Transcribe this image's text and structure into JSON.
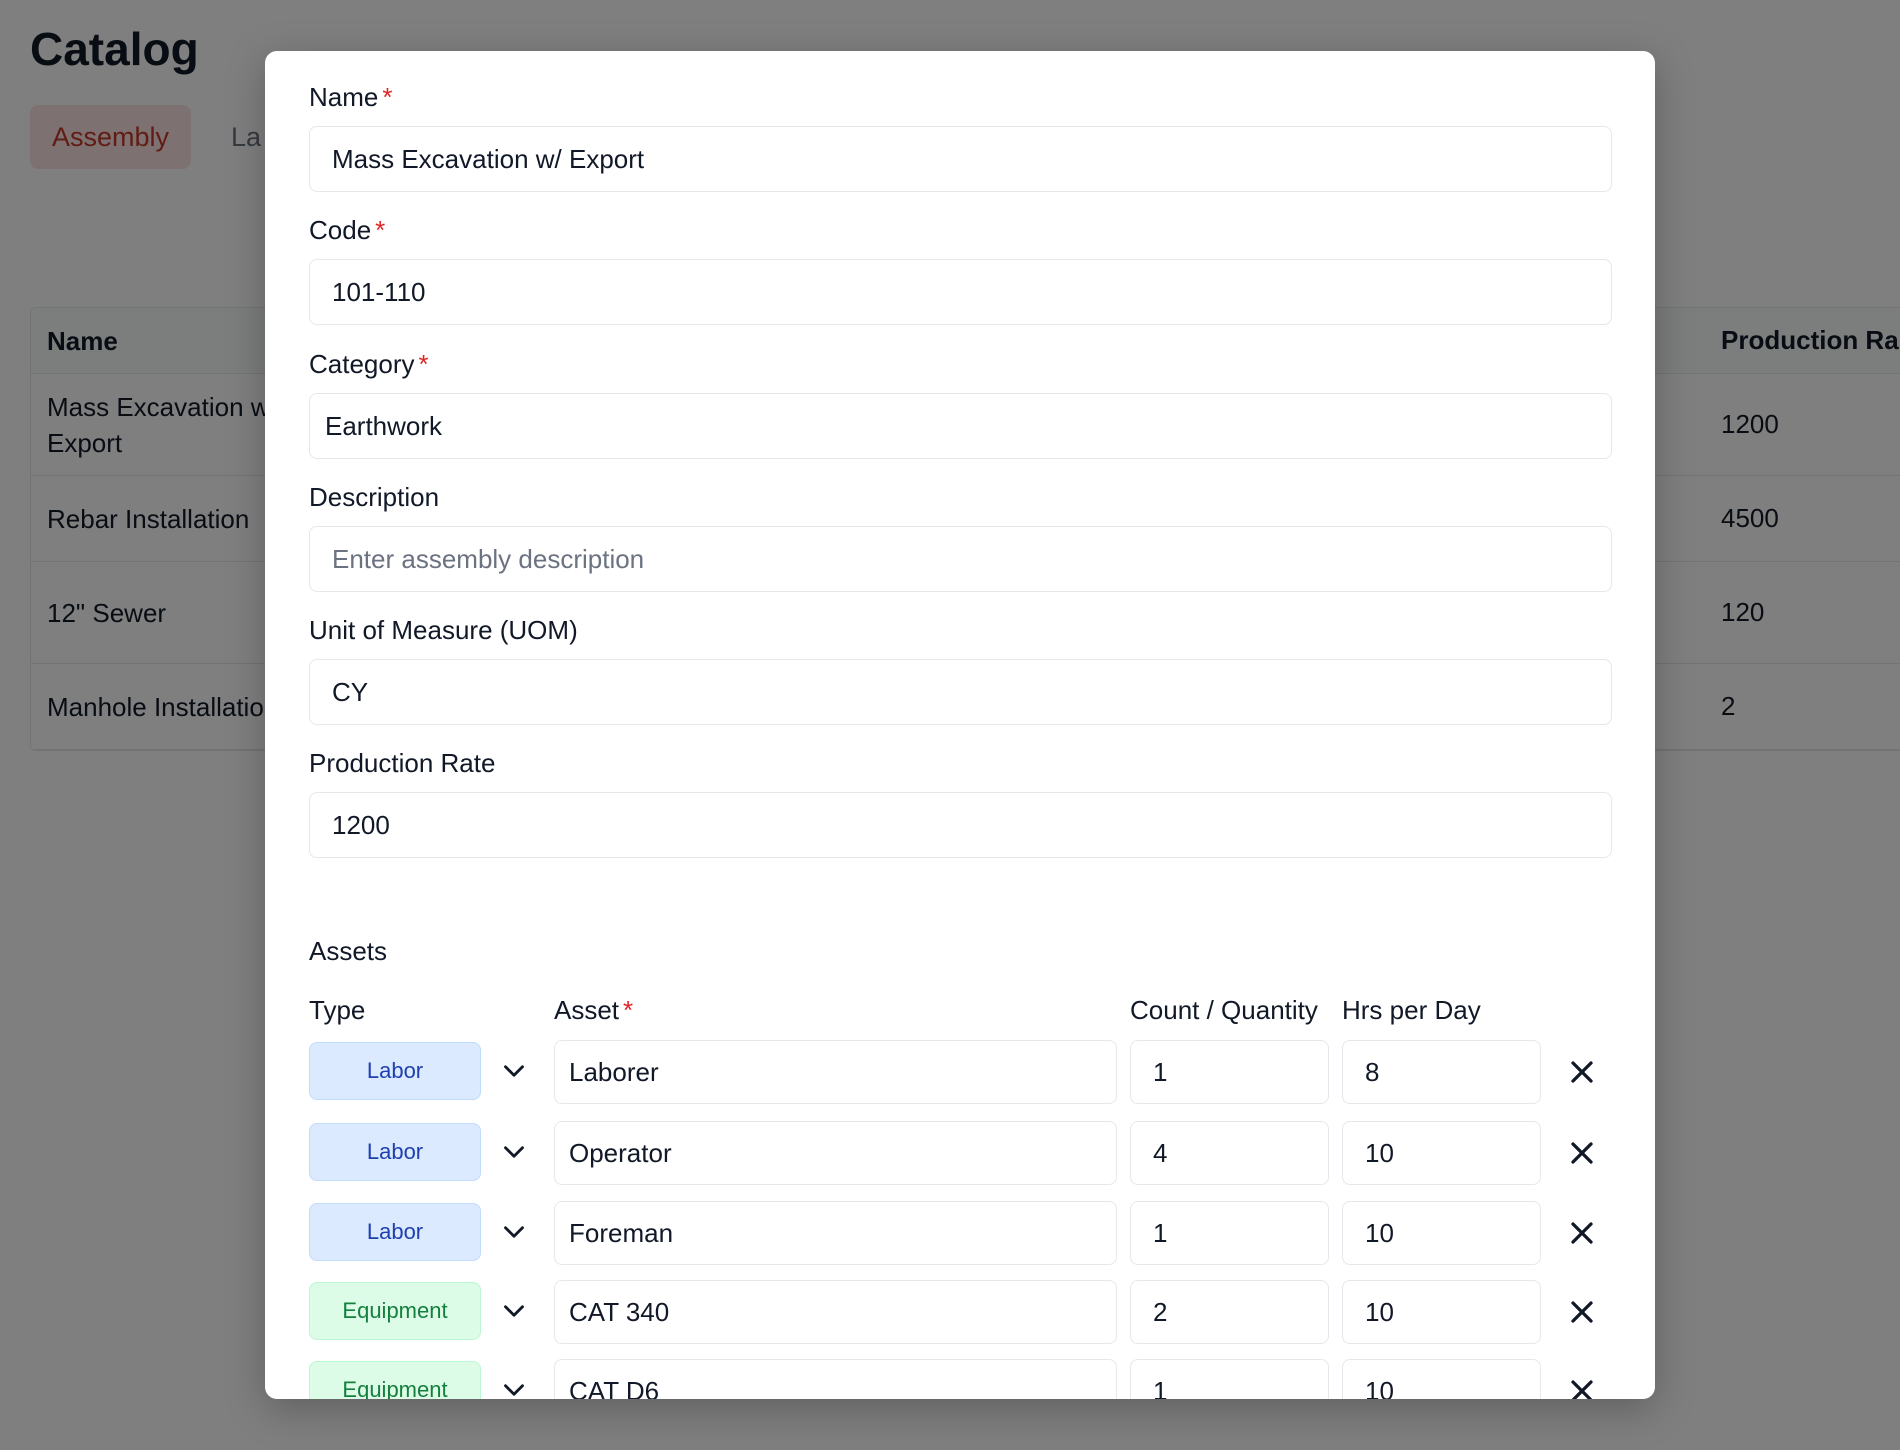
{
  "page": {
    "title": "Catalog",
    "tabs": [
      {
        "label": "Assembly"
      },
      {
        "label": "La"
      }
    ],
    "table": {
      "headers": {
        "name": "Name",
        "rate": "Production Ra"
      },
      "rows": [
        {
          "name": "Mass Excavation w/\nExport",
          "rate": "1200"
        },
        {
          "name": "Rebar Installation",
          "rate": "4500"
        },
        {
          "name": "12\" Sewer",
          "rate": "120"
        },
        {
          "name": "Manhole Installatio",
          "rate": "2"
        }
      ]
    }
  },
  "modal": {
    "fields": {
      "name": {
        "label": "Name",
        "required": "*",
        "value": "Mass Excavation w/ Export"
      },
      "code": {
        "label": "Code",
        "required": "*",
        "value": "101-110"
      },
      "category": {
        "label": "Category",
        "required": "*",
        "value": "Earthwork"
      },
      "description": {
        "label": "Description",
        "placeholder": "Enter assembly description"
      },
      "uom": {
        "label": "Unit of Measure (UOM)",
        "value": "CY"
      },
      "rate": {
        "label": "Production Rate",
        "value": "1200"
      }
    },
    "assets": {
      "title": "Assets",
      "columns": {
        "type": "Type",
        "asset": "Asset",
        "asset_required": "*",
        "count": "Count / Quantity",
        "hrs": "Hrs per Day"
      },
      "rows": [
        {
          "type": "Labor",
          "asset": "Laborer",
          "count": "1",
          "hrs": "8"
        },
        {
          "type": "Labor",
          "asset": "Operator",
          "count": "4",
          "hrs": "10"
        },
        {
          "type": "Labor",
          "asset": "Foreman",
          "count": "1",
          "hrs": "10"
        },
        {
          "type": "Equipment",
          "asset": "CAT 340",
          "count": "2",
          "hrs": "10"
        },
        {
          "type": "Equipment",
          "asset": "CAT D6",
          "count": "1",
          "hrs": "10"
        }
      ]
    }
  },
  "icons": {
    "type_dropdown": "chevron-down-icon",
    "remove_row": "close-icon"
  },
  "colors": {
    "labor": "#dbeafe",
    "equipment": "#dcfce7",
    "required": "#dc2626",
    "active_tab": "#c0392b"
  }
}
